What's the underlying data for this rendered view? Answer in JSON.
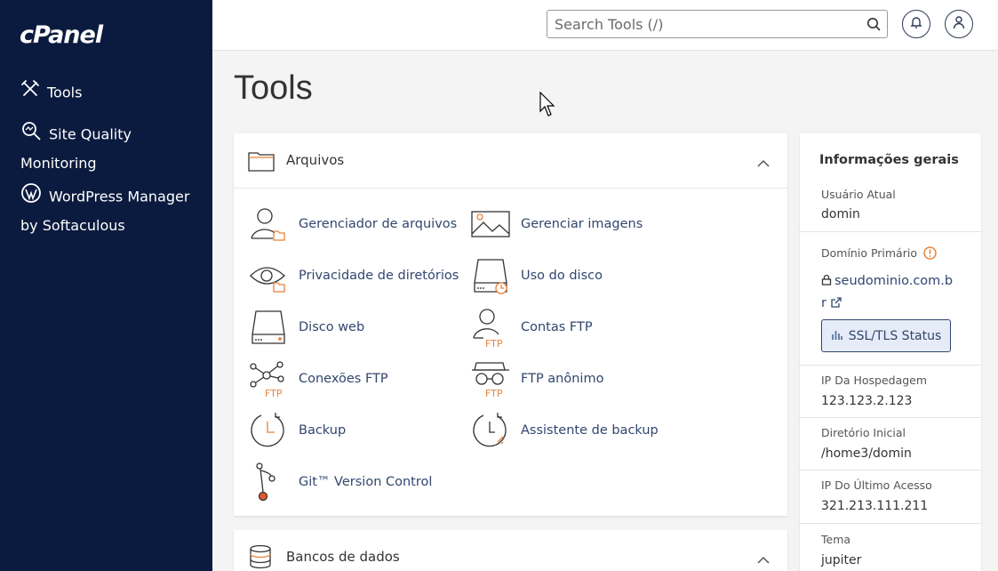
{
  "brand": {
    "logo_text": "cPanel"
  },
  "sidebar": {
    "items": [
      {
        "label": "Tools",
        "icon": "tools-icon"
      },
      {
        "label": "Site Quality Monitoring",
        "icon": "magnifier-icon"
      },
      {
        "label": "WordPress Manager by Softaculous",
        "icon": "wordpress-icon"
      }
    ]
  },
  "header": {
    "search_placeholder": "Search Tools (/)",
    "icons": [
      "bell-icon",
      "user-icon"
    ]
  },
  "page": {
    "title": "Tools"
  },
  "sections": [
    {
      "title": "Arquivos",
      "icon": "folder-icon",
      "tools": [
        {
          "label": "Gerenciador de arquivos",
          "icon": "file-manager-icon"
        },
        {
          "label": "Gerenciar imagens",
          "icon": "image-icon"
        },
        {
          "label": "Privacidade de diretórios",
          "icon": "eye-folder-icon"
        },
        {
          "label": "Uso do disco",
          "icon": "disk-usage-icon"
        },
        {
          "label": "Disco web",
          "icon": "web-disk-icon"
        },
        {
          "label": "Contas FTP",
          "icon": "ftp-accounts-icon"
        },
        {
          "label": "Conexões FTP",
          "icon": "ftp-connections-icon"
        },
        {
          "label": "FTP anônimo",
          "icon": "anonymous-ftp-icon"
        },
        {
          "label": "Backup",
          "icon": "backup-icon"
        },
        {
          "label": "Assistente de backup",
          "icon": "backup-wizard-icon"
        },
        {
          "label": "Git™ Version Control",
          "icon": "git-icon"
        }
      ]
    },
    {
      "title": "Bancos de dados",
      "icon": "database-icon"
    }
  ],
  "general_info": {
    "title": "Informações gerais",
    "current_user_label": "Usuário Atual",
    "current_user": "domin",
    "primary_domain_label": "Domínio Primário",
    "primary_domain": "seudominio.com.br",
    "ssl_button": "SSL/TLS Status",
    "hosting_ip_label": "IP Da Hospedagem",
    "hosting_ip": "123.123.2.123",
    "home_dir_label": "Diretório Inicial",
    "home_dir": "/home3/domin",
    "last_ip_label": "IP Do Último Acesso",
    "last_ip": "321.213.111.211",
    "theme_label": "Tema",
    "theme": "jupiter"
  },
  "colors": {
    "sidebar_bg": "#0b1b3f",
    "link": "#31466e",
    "accent_orange": "#e8823a",
    "warning": "#e8823a"
  }
}
